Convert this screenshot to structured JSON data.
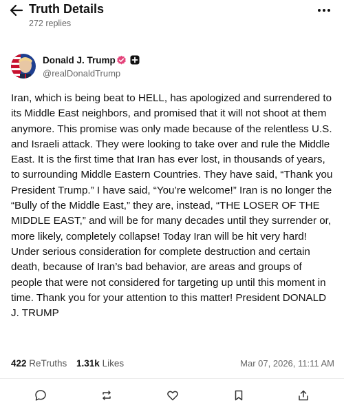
{
  "header": {
    "title": "Truth Details",
    "replies": "272 replies",
    "back_icon": "arrow-left-icon",
    "more_icon": "more-dots-icon"
  },
  "author": {
    "name": "Donald J. Trump",
    "handle": "@realDonaldTrump",
    "verified_color": "#e4447b"
  },
  "post": {
    "text": "Iran, which is being beat to HELL, has apologized and surrendered to its Middle East neighbors, and promised that it will not shoot at them anymore. This promise was only made because of the relentless U.S. and Israeli attack. They were looking to take over and rule the Middle East. It is the first time that Iran has ever lost, in thousands of years, to surrounding Middle Eastern Countries. They have said, “Thank you President Trump.” I have said, “You’re welcome!” Iran is no longer the “Bully of the Middle East,” they are, instead, “THE LOSER OF THE MIDDLE EAST,” and will be for many decades until they surrender or, more likely, completely collapse! Today Iran will be hit very hard! Under serious consideration for complete destruction and certain death, because of Iran’s bad behavior, are areas and groups of people that were not considered for targeting up until this moment in time. Thank you for your attention to this matter! President DONALD J. TRUMP"
  },
  "stats": {
    "retruths_count": "422",
    "retruths_label": "ReTruths",
    "likes_count": "1.31k",
    "likes_label": "Likes",
    "timestamp": "Mar 07, 2026, 11:11 AM"
  },
  "actions": [
    "reply-icon",
    "retruth-icon",
    "like-icon",
    "bookmark-icon",
    "share-icon"
  ]
}
